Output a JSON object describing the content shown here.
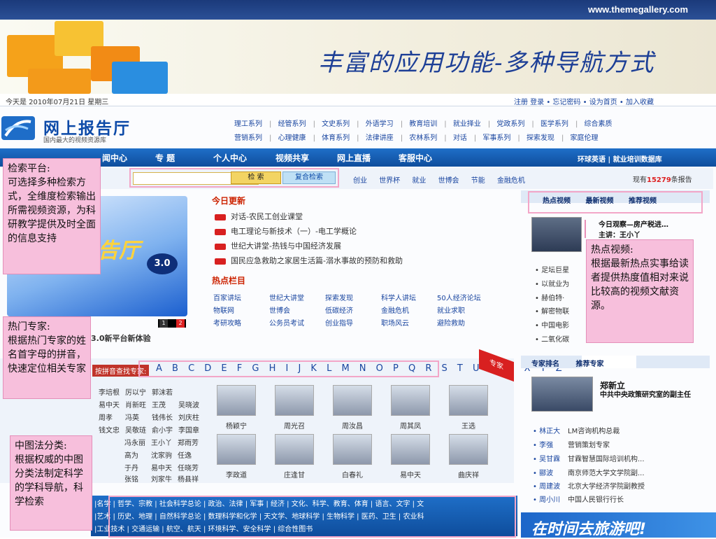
{
  "slide": {
    "url": "www.themegallery.com",
    "title": "丰富的应用功能-多种导航方式"
  },
  "site": {
    "date": "今天是  2010年07月21日  星期三",
    "util_links": "注册  登录  • 忘记密码  • 设为首页  • 加入收藏",
    "logo_title": "网上报告厅",
    "logo_sub": "国内最大的视频资源库",
    "categories_row1": [
      "理工系列",
      "经管系列",
      "文史系列",
      "外语学习",
      "教育培训",
      "就业择业",
      "党政系列",
      "医学系列",
      "综合素质"
    ],
    "categories_row2": [
      "营销系列",
      "心理健康",
      "体育系列",
      "法律讲座",
      "农林系列",
      "对话",
      "军事系列",
      "探索发现",
      "家庭伦理"
    ],
    "nav": [
      "闻中心",
      "专  题",
      "个人中心",
      "视频共享",
      "网上直播",
      "客服中心"
    ],
    "nav_right": "环球英语  |  就业培训数据库",
    "search": {
      "placeholder": "",
      "search_label": "检  索",
      "advanced_label": "复合检索"
    },
    "quick_links": [
      "创业",
      "世界杯",
      "就业",
      "世博会",
      "节能",
      "金融危机"
    ],
    "report_count_prefix": "现有",
    "report_count": "15279",
    "report_count_suffix": "条报告",
    "promo": {
      "word": "告厅",
      "version": "3.0",
      "caption": "3.0新平台新体验",
      "pages": [
        "1",
        "2"
      ]
    },
    "today": {
      "title": "今日更新",
      "items": [
        "对话-农民工创业课堂",
        "电工理论与新技术（一）-电工学概论",
        "世纪大讲堂-热钱与中国经济发展",
        "国民应急救助之家居生活篇-溺水事故的预防和救助"
      ]
    },
    "hot_columns": {
      "title": "热点栏目",
      "rows": [
        [
          "百家讲坛",
          "世纪大讲堂",
          "探索发现",
          "科学人讲坛",
          "50人经济论坛"
        ],
        [
          "物联网",
          "世博会",
          "低碳经济",
          "金融危机",
          "就业求职"
        ],
        [
          "考研攻略",
          "公务员考试",
          "创业指导",
          "职场风云",
          "避险救助"
        ]
      ]
    },
    "hot_video": {
      "tabs": [
        "热点视频",
        "最新视频",
        "推荐视频"
      ],
      "title": "今日观察—房产税进…",
      "host": "主讲：王小丫",
      "list": [
        "• 足坛巨星",
        "• 以就业为",
        "• 赫伯特·",
        "• 解密物联",
        "• 中国电影",
        "• 二氧化碳"
      ]
    },
    "experts": {
      "alpha_label": "按拼音查找专家:",
      "alphabet": "A B C D E F G H I J K L M N O P Q R S T U V W X Y Z",
      "ribbon": "专家",
      "names": [
        [
          "",
          "李培根",
          "厉以宁",
          "郭沫若"
        ],
        [
          "",
          "易中天",
          "肖新旺",
          "王茂",
          "吴晓波"
        ],
        [
          "",
          "周孝",
          "冯英",
          "钱伟长",
          "刘庆柱"
        ],
        [
          "",
          "钱文忠",
          "吴敬琏",
          "俞小宇",
          "李国章"
        ],
        [
          "",
          "冯永丽",
          "王小丫",
          "郑雨芳"
        ],
        [
          "",
          "高为",
          "沈家驹",
          "任逸"
        ],
        [
          "",
          "于丹",
          "易中天",
          "任晓芳"
        ],
        [
          "",
          "张铭",
          "刘家牛",
          "杨县祥"
        ]
      ],
      "photos_row1": [
        "杨颖宁",
        "周光召",
        "周汝昌",
        "周其凤",
        "王选"
      ],
      "photos_row2": [
        "李政道",
        "庄逢甘",
        "白春礼",
        "易中天",
        "曲庆祥"
      ]
    },
    "featured_expert": {
      "tabs": [
        "专家排名",
        "推荐专家"
      ],
      "name": "郑新立",
      "title": "中共中央政策研究室的副主任",
      "list": [
        {
          "name": "• 林正大",
          "desc": "LM咨询机构总裁"
        },
        {
          "name": "• 李强",
          "desc": "营销策划专家"
        },
        {
          "name": "• 吴甘霖",
          "desc": "甘霖智慧国际培训机构..."
        },
        {
          "name": "• 郦波",
          "desc": "南京师范大学文学院副..."
        },
        {
          "name": "• 周建波",
          "desc": "北京大学经济学院副教授"
        },
        {
          "name": "• 周小川",
          "desc": "中国人民银行行长"
        }
      ]
    },
    "classification": [
      "|名学 | 哲学、宗教 | 社会科学总论 | 政治、法律 | 军事 | 经济 | 文化、科学、教育、体育 | 语言、文字 | 文",
      "|艺术 | 历史、地理 | 自然科学总论 | 数理科学和化学 | 天文学、地球科学 | 生物科学 | 医药、卫生 | 农业科",
      "|工业技术 | 交通运输 | 航空、航天 | 环境科学、安全科学 | 综合性图书"
    ],
    "bottom_ad": "在时间去旅游吧!"
  },
  "callouts": {
    "search": "检索平台:\n可选择多种检索方式，全维度检索输出所需视频资源，为科研教学提供及时全面的信息支持",
    "experts": "热门专家:\n根据热门专家的姓名首字母的拼音，快速定位相关专家",
    "hot_video": "热点视频:\n根据最新热点实事给读者提供热度值相对来说比较高的视频文献资源。",
    "classification": "中图法分类:\n根据权威的中图分类法制定科学的学科导航，科学检索"
  }
}
